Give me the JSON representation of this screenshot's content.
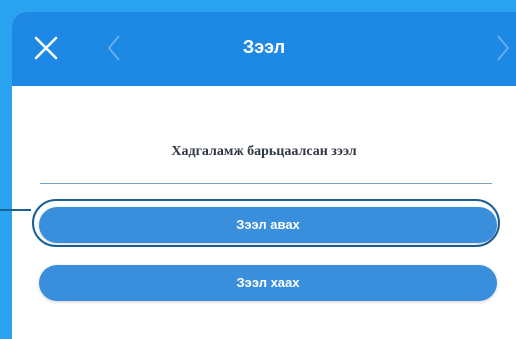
{
  "header": {
    "title": "Зээл",
    "close_icon": "close-icon",
    "back_icon": "chevron-left-icon",
    "forward_icon": "chevron-right-icon"
  },
  "content": {
    "section_title": "Хадгаламж барьцаалсан зээл",
    "buttons": [
      {
        "label": "Зээл авах",
        "focused": true
      },
      {
        "label": "Зээл хаах",
        "focused": false
      }
    ]
  },
  "colors": {
    "background": "#29a3f0",
    "header": "#1e88e5",
    "button": "#3a8fdc",
    "focus_ring": "#1a5f96"
  }
}
